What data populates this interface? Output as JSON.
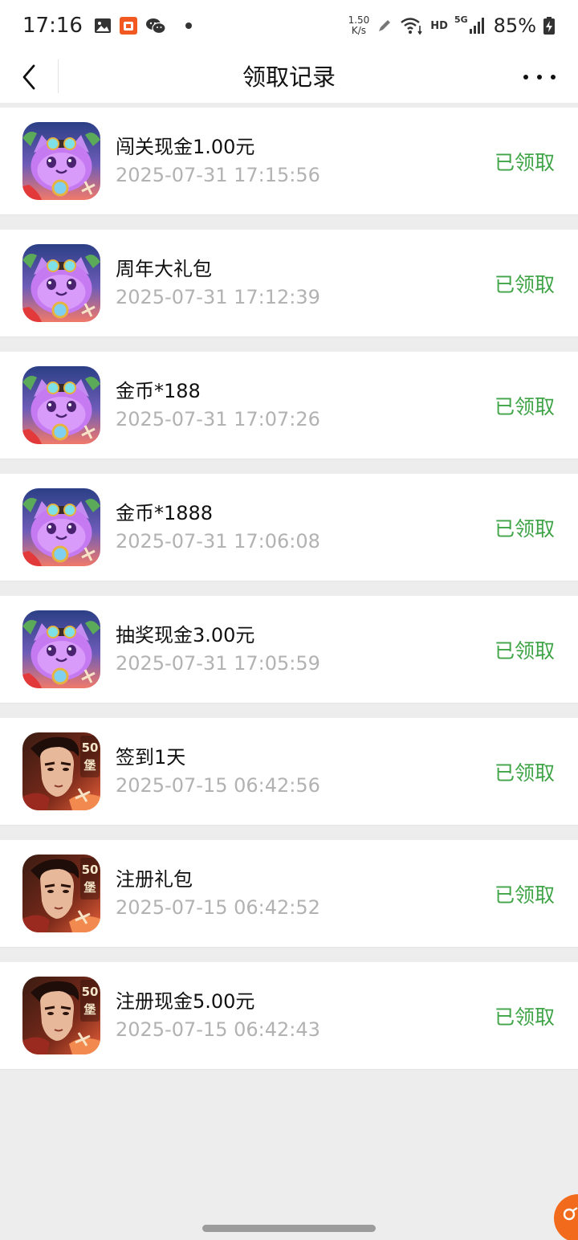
{
  "status_bar": {
    "time": "17:16",
    "speed_value": "1.50",
    "speed_unit": "K/s",
    "hd": "HD",
    "net": "5G",
    "battery": "85%"
  },
  "nav": {
    "title": "领取记录"
  },
  "records": [
    {
      "title": "闯关现金1.00元",
      "time": "2025-07-31 17:15:56",
      "status": "已领取",
      "icon": "cat-game-icon"
    },
    {
      "title": "周年大礼包",
      "time": "2025-07-31 17:12:39",
      "status": "已领取",
      "icon": "cat-game-icon"
    },
    {
      "title": "金币*188",
      "time": "2025-07-31 17:07:26",
      "status": "已领取",
      "icon": "cat-game-icon"
    },
    {
      "title": "金币*1888",
      "time": "2025-07-31 17:06:08",
      "status": "已领取",
      "icon": "cat-game-icon"
    },
    {
      "title": "抽奖现金3.00元",
      "time": "2025-07-31 17:05:59",
      "status": "已领取",
      "icon": "cat-game-icon"
    },
    {
      "title": "签到1天",
      "time": "2025-07-15 06:42:56",
      "status": "已领取",
      "icon": "warrior-game-icon"
    },
    {
      "title": "注册礼包",
      "time": "2025-07-15 06:42:52",
      "status": "已领取",
      "icon": "warrior-game-icon"
    },
    {
      "title": "注册现金5.00元",
      "time": "2025-07-15 06:42:43",
      "status": "已领取",
      "icon": "warrior-game-icon"
    }
  ],
  "warrior_badge": "50堡",
  "colors": {
    "status_green": "#3FA447",
    "time_gray": "#B2B2B2",
    "page_bg": "#EDEDED"
  }
}
